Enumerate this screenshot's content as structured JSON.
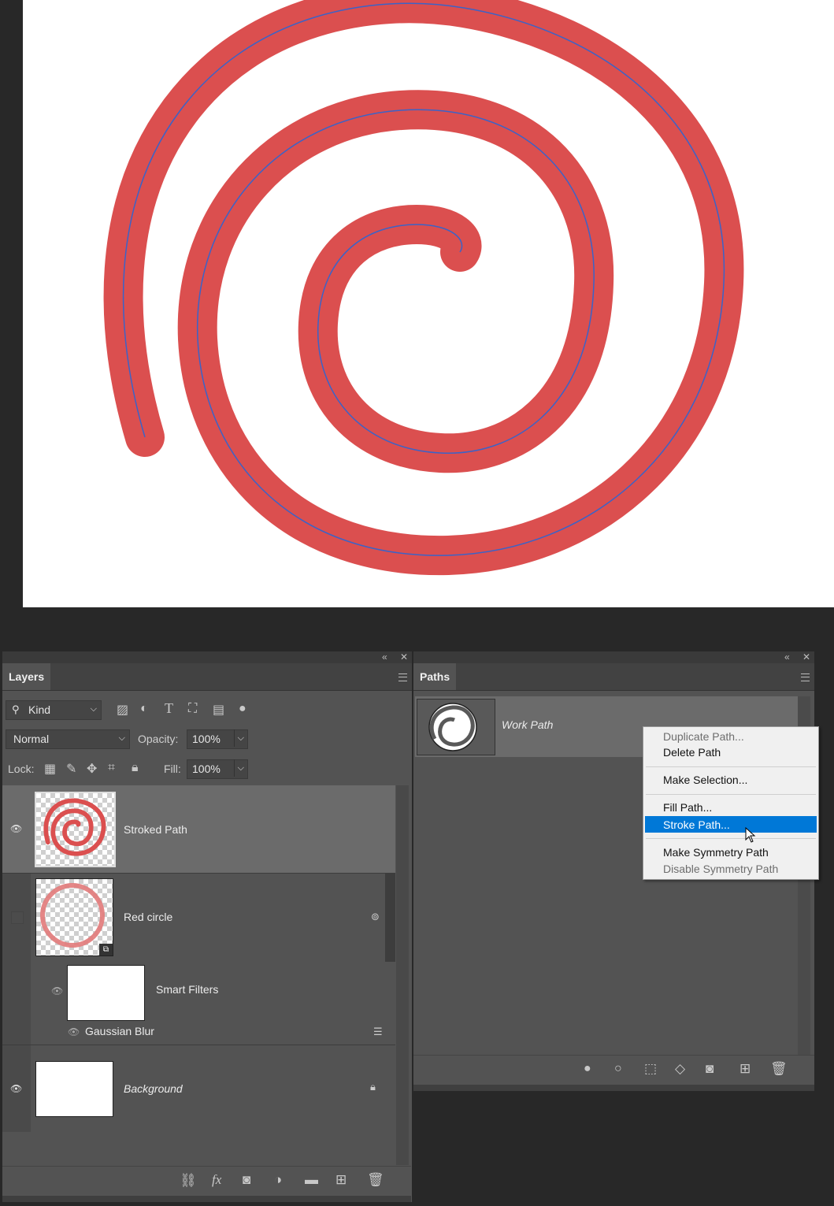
{
  "layers_panel": {
    "tab": "Layers",
    "filter": {
      "kind_label": "Kind"
    },
    "blend_mode": "Normal",
    "opacity_label": "Opacity:",
    "opacity_value": "100%",
    "lock_label": "Lock:",
    "fill_label": "Fill:",
    "fill_value": "100%",
    "layers": [
      {
        "name": "Stroked Path",
        "visible": true,
        "selected": true
      },
      {
        "name": "Red circle",
        "visible": false,
        "smart_object": true
      },
      {
        "name": "Smart Filters",
        "is_filter_group": true
      },
      {
        "name": "Gaussian Blur",
        "is_filter": true
      },
      {
        "name": "Background",
        "visible": true,
        "locked": true
      }
    ]
  },
  "paths_panel": {
    "tab": "Paths",
    "paths": [
      {
        "name": "Work Path"
      }
    ]
  },
  "context_menu": {
    "items": [
      {
        "label": "Duplicate Path...",
        "enabled": false
      },
      {
        "label": "Delete Path",
        "enabled": true
      },
      {
        "label": "Make Selection...",
        "enabled": true
      },
      {
        "label": "Fill Path...",
        "enabled": true
      },
      {
        "label": "Stroke Path...",
        "enabled": true,
        "highlighted": true
      },
      {
        "label": "Make Symmetry Path",
        "enabled": true
      },
      {
        "label": "Disable Symmetry Path",
        "enabled": false
      }
    ]
  },
  "colors": {
    "stroke_red": "#db4f4f",
    "path_blue": "#3a63c8",
    "panel_bg": "#535353",
    "menu_highlight": "#0078d7"
  }
}
